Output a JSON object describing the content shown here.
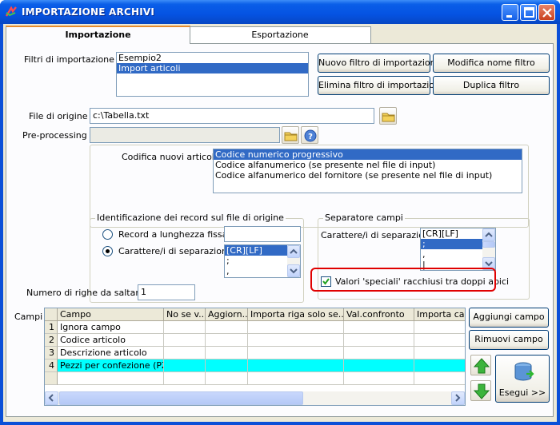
{
  "window": {
    "title": "IMPORTAZIONE ARCHIVI"
  },
  "tabs": [
    {
      "label": "Importazione"
    },
    {
      "label": "Esportazione"
    }
  ],
  "filters": {
    "label": "Filtri di importazione :",
    "items": [
      {
        "label": "Esempio2"
      },
      {
        "label": "Import articoli"
      }
    ],
    "selected_index": 1
  },
  "buttons": {
    "new_filter": "Nuovo filtro di importazione",
    "rename_filter": "Modifica nome filtro",
    "delete_filter": "Elimina filtro di importazione",
    "duplicate_filter": "Duplica filtro",
    "add_field": "Aggiungi campo",
    "remove_field": "Rimuovi campo",
    "run": "Esegui >>"
  },
  "source_file": {
    "label": "File di origine :",
    "value": "c:\\Tabella.txt"
  },
  "preprocessing": {
    "label": "Pre-processing :",
    "value": ""
  },
  "encoding": {
    "label": "Codifica nuovi articoli :",
    "items": [
      {
        "label": "Codice numerico progressivo"
      },
      {
        "label": "Codice alfanumerico (se presente nel file di input)"
      },
      {
        "label": "Codice alfanumerico del fornitore (se presente nel file di input)"
      }
    ],
    "selected_index": 0
  },
  "record_id": {
    "title": "Identificazione dei record sul file di origine",
    "fixed_length_label": "Record a lunghezza fissa",
    "fixed_length_value": "",
    "separator_label": "Carattere/i di separazione",
    "separator_options": [
      {
        "label": "[CR][LF]"
      },
      {
        "label": ";"
      },
      {
        "label": ","
      }
    ],
    "selected": "separator"
  },
  "field_separator": {
    "title": "Separatore campi",
    "label": "Carattere/i di separazione",
    "options": [
      {
        "label": "[CR][LF]"
      },
      {
        "label": ";"
      },
      {
        "label": ","
      },
      {
        "label": "|"
      }
    ],
    "selected_index": 1,
    "quotes_label": "Valori 'speciali' racchiusi tra doppi apici",
    "quotes_checked": true
  },
  "skip_rows": {
    "label": "Numero di righe da saltare :",
    "value": "1"
  },
  "fields": {
    "label": "Campi :",
    "columns": [
      "Campo",
      "No se v...",
      "Aggiorn...",
      "Importa riga solo se...",
      "Val.confronto",
      "Importa ca"
    ],
    "rows": [
      {
        "num": "1",
        "campo": "Ignora campo"
      },
      {
        "num": "2",
        "campo": "Codice articolo"
      },
      {
        "num": "3",
        "campo": "Descrizione articolo"
      },
      {
        "num": "4",
        "campo": "Pezzi per confezione (PZ..."
      }
    ],
    "selected_row": 4
  },
  "colors": {
    "accent": "#316ac5",
    "highlight": "#e00000",
    "selected_row": "#00ffff"
  }
}
